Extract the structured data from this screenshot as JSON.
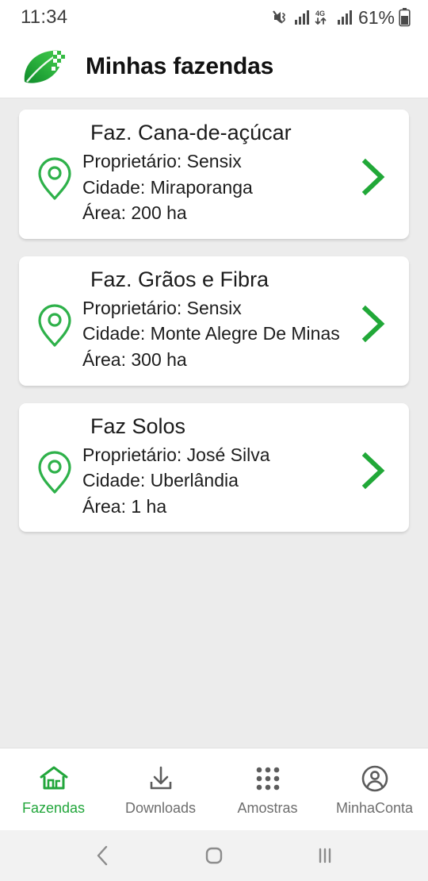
{
  "status_bar": {
    "time": "11:34",
    "battery_percent": "61%",
    "network_label": "4G",
    "icons": [
      "mute-icon",
      "signal-bars-icon",
      "4g-data-icon",
      "signal-bars-icon",
      "battery-icon"
    ]
  },
  "header": {
    "title": "Minhas fazendas",
    "logo": "leaf-logo"
  },
  "colors": {
    "accent_green": "#22a63b",
    "pin_green": "#2eb14a",
    "chevron_green": "#21a838",
    "page_background": "#ececec",
    "card_background": "#ffffff",
    "text_primary": "#1b1b1b",
    "nav_inactive": "#6e6e6e"
  },
  "labels": {
    "owner_prefix": "Proprietário:",
    "city_prefix": "Cidade:",
    "area_prefix": "Área:"
  },
  "farms": [
    {
      "name": "Faz. Cana-de-açúcar",
      "owner": "Proprietário: Sensix",
      "city": "Cidade: Miraporanga",
      "area": "Área: 200 ha"
    },
    {
      "name": "Faz. Grãos e Fibra",
      "owner": "Proprietário: Sensix",
      "city": "Cidade: Monte Alegre De Minas",
      "area": "Área: 300 ha"
    },
    {
      "name": "Faz Solos",
      "owner": "Proprietário: José Silva",
      "city": "Cidade: Uberlândia",
      "area": "Área: 1 ha"
    }
  ],
  "bottom_nav": {
    "items": [
      {
        "label": "Fazendas",
        "icon": "home-icon",
        "active": true
      },
      {
        "label": "Downloads",
        "icon": "download-icon",
        "active": false
      },
      {
        "label": "Amostras",
        "icon": "grid-dots-icon",
        "active": false
      },
      {
        "label": "MinhaConta",
        "icon": "account-circle-icon",
        "active": false
      }
    ]
  },
  "system_nav": {
    "back": "back-chevron-icon",
    "home": "home-square-icon",
    "recents": "recents-bars-icon"
  }
}
